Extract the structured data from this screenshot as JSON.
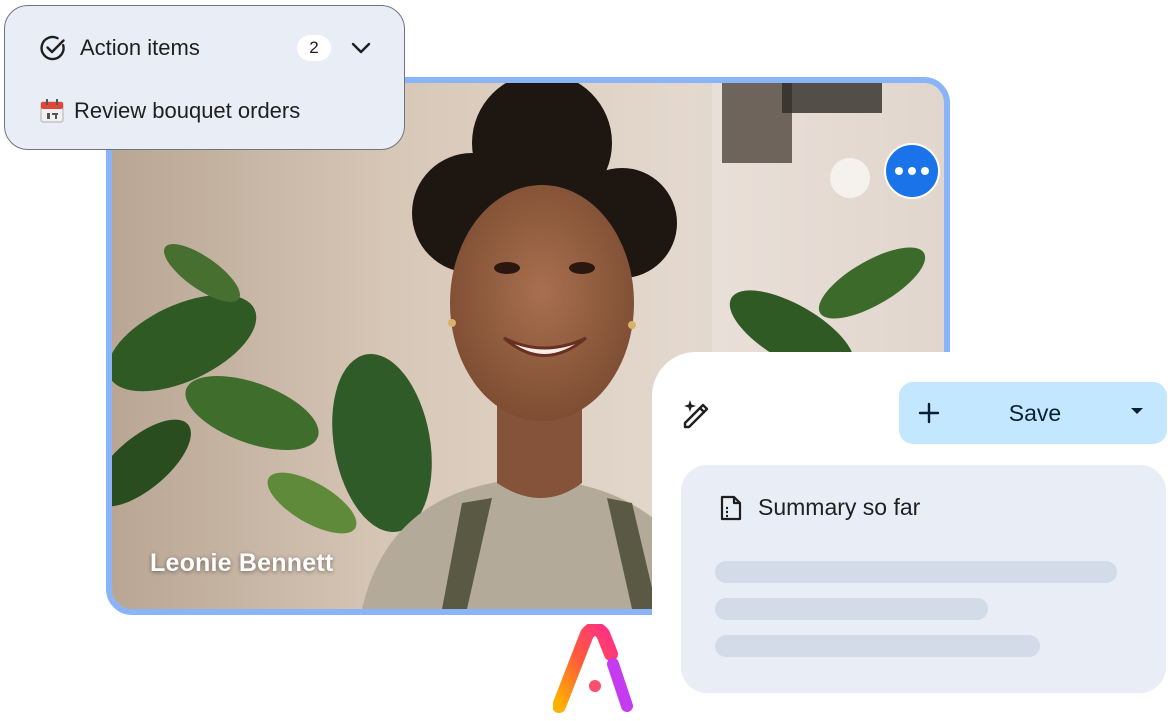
{
  "participant": {
    "name": "Leonie Bennett"
  },
  "action_items": {
    "title": "Action items",
    "count": "2",
    "items": [
      {
        "label": "Review bouquet orders",
        "icon": "calendar-icon"
      }
    ]
  },
  "summary_panel": {
    "save_label": "Save",
    "summary_title": "Summary so far"
  },
  "colors": {
    "tile_border": "#8ab4f8",
    "more_button": "#1a73e8",
    "save_button": "#c2e7ff",
    "card_background": "#e8edf6",
    "skeleton": "#d3dbe8"
  }
}
